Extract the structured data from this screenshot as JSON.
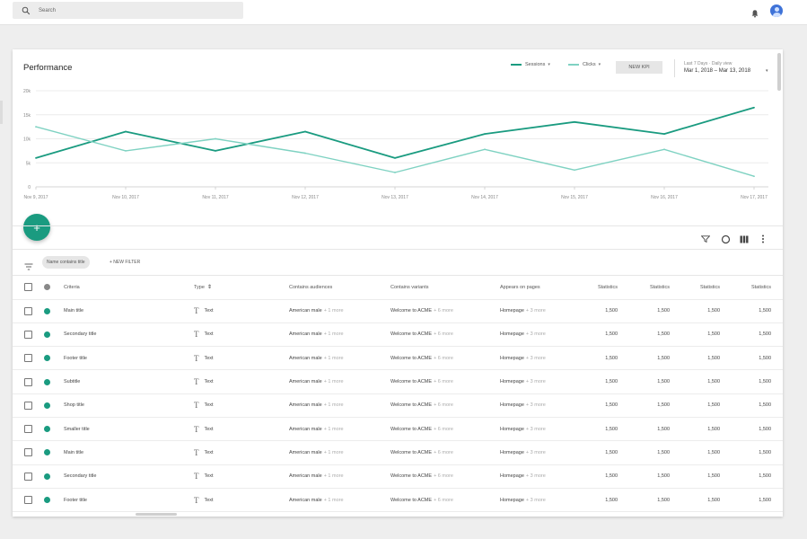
{
  "topbar": {
    "search_placeholder": "Search"
  },
  "card": {
    "title": "Performance",
    "legend": [
      {
        "label": "Sessions",
        "color": "#1a9b80"
      },
      {
        "label": "Clicks",
        "color": "#7fd2c2"
      }
    ],
    "new_kpi_label": "NEW KPI",
    "date_label": "Last 7 Days · Daily view",
    "date_range": "Mar 1, 2018 – Mar 13, 2018"
  },
  "chart_data": {
    "type": "line",
    "x": [
      "Nov 9, 2017",
      "Nov 10, 2017",
      "Nov 11, 2017",
      "Nov 12, 2017",
      "Nov 13, 2017",
      "Nov 14, 2017",
      "Nov 15, 2017",
      "Nov 16, 2017",
      "Nov 17, 2017"
    ],
    "yticks": [
      "20k",
      "15k",
      "10k",
      "5k",
      "0"
    ],
    "ylim": [
      0,
      20000
    ],
    "series": [
      {
        "name": "Sessions",
        "color": "#1a9b80",
        "values": [
          6000,
          11500,
          7500,
          11500,
          6000,
          11000,
          13500,
          11000,
          16500
        ]
      },
      {
        "name": "Clicks",
        "color": "#7fd2c2",
        "values": [
          12500,
          7500,
          10000,
          7000,
          3000,
          7800,
          3500,
          7800,
          2200
        ]
      }
    ],
    "grid": true,
    "legend": "top-right"
  },
  "filters": {
    "chip": "Name contains title",
    "add_filter": "+ NEW FILTER"
  },
  "table": {
    "headers": [
      "Criteria",
      "Type",
      "Contains audiences",
      "Contains variants",
      "Appears on pages",
      "Statistics",
      "Statistics",
      "Statistics",
      "Statistics"
    ],
    "rows": [
      {
        "name": "Main title",
        "type": "Text",
        "audience": "American male",
        "audience_more": "+ 1 more",
        "variant": "Welcome to ACME",
        "variant_more": "+ 6 more",
        "page": "Homepage",
        "page_more": "+ 3 more",
        "s1": "1,500",
        "s2": "1,500",
        "s3": "1,500",
        "s4": "1,500"
      },
      {
        "name": "Secondary title",
        "type": "Text",
        "audience": "American male",
        "audience_more": "+ 1 more",
        "variant": "Welcome to ACME",
        "variant_more": "+ 6 more",
        "page": "Homepage",
        "page_more": "+ 3 more",
        "s1": "1,500",
        "s2": "1,500",
        "s3": "1,500",
        "s4": "1,500"
      },
      {
        "name": "Footer title",
        "type": "Text",
        "audience": "American male",
        "audience_more": "+ 1 more",
        "variant": "Welcome to ACME",
        "variant_more": "+ 6 more",
        "page": "Homepage",
        "page_more": "+ 3 more",
        "s1": "1,500",
        "s2": "1,500",
        "s3": "1,500",
        "s4": "1,500"
      },
      {
        "name": "Subtitle",
        "type": "Text",
        "audience": "American male",
        "audience_more": "+ 1 more",
        "variant": "Welcome to ACME",
        "variant_more": "+ 6 more",
        "page": "Homepage",
        "page_more": "+ 3 more",
        "s1": "1,500",
        "s2": "1,500",
        "s3": "1,500",
        "s4": "1,500"
      },
      {
        "name": "Shop title",
        "type": "Text",
        "audience": "American male",
        "audience_more": "+ 1 more",
        "variant": "Welcome to ACME",
        "variant_more": "+ 6 more",
        "page": "Homepage",
        "page_more": "+ 3 more",
        "s1": "1,500",
        "s2": "1,500",
        "s3": "1,500",
        "s4": "1,500"
      },
      {
        "name": "Smaller title",
        "type": "Text",
        "audience": "American male",
        "audience_more": "+ 1 more",
        "variant": "Welcome to ACME",
        "variant_more": "+ 6 more",
        "page": "Homepage",
        "page_more": "+ 3 more",
        "s1": "1,500",
        "s2": "1,500",
        "s3": "1,500",
        "s4": "1,500"
      },
      {
        "name": "Main title",
        "type": "Text",
        "audience": "American male",
        "audience_more": "+ 1 more",
        "variant": "Welcome to ACME",
        "variant_more": "+ 6 more",
        "page": "Homepage",
        "page_more": "+ 3 more",
        "s1": "1,500",
        "s2": "1,500",
        "s3": "1,500",
        "s4": "1,500"
      },
      {
        "name": "Secondary title",
        "type": "Text",
        "audience": "American male",
        "audience_more": "+ 1 more",
        "variant": "Welcome to ACME",
        "variant_more": "+ 6 more",
        "page": "Homepage",
        "page_more": "+ 3 more",
        "s1": "1,500",
        "s2": "1,500",
        "s3": "1,500",
        "s4": "1,500"
      },
      {
        "name": "Footer title",
        "type": "Text",
        "audience": "American male",
        "audience_more": "+ 1 more",
        "variant": "Welcome to ACME",
        "variant_more": "+ 6 more",
        "page": "Homepage",
        "page_more": "+ 3 more",
        "s1": "1,500",
        "s2": "1,500",
        "s3": "1,500",
        "s4": "1,500"
      }
    ]
  },
  "colors": {
    "accent": "#1a9b80",
    "accent_light": "#7fd2c2",
    "status_dot": "#1a9b80",
    "header_dot": "#888888"
  },
  "icons": {
    "search": "search-icon",
    "bell": "bell-icon",
    "avatar": "user-avatar-icon",
    "add": "plus-icon",
    "filter": "filter-icon",
    "refresh": "refresh-icon",
    "columns": "columns-icon",
    "more": "more-vert-icon",
    "sort": "sort-icon",
    "type": "text-type-icon"
  }
}
